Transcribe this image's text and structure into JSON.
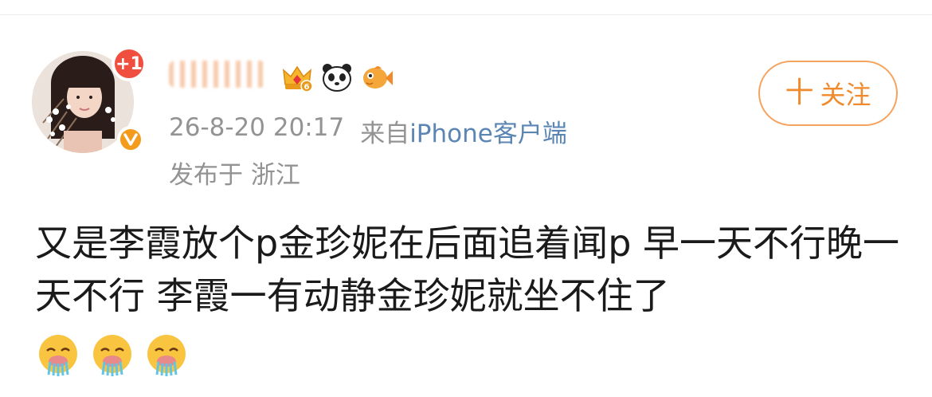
{
  "post": {
    "author": {
      "follower_badge": "+1"
    },
    "follow_button": {
      "plus": "十",
      "label": "关注"
    },
    "timestamp": "26-8-20 20:17",
    "source_prefix": "来自",
    "source": "iPhone客户端",
    "location": "发布于 浙江",
    "content": "又是李霞放个p金珍妮在后面追着闻p 早一天不行晚一天不行 李霞一有动静金珍妮就坐不住了",
    "icons": {
      "badges": [
        "crown-level-6-badge-icon",
        "panda-badge-icon",
        "fish-badge-icon"
      ],
      "emojis": [
        "vomit-emoji-icon",
        "vomit-emoji-icon",
        "vomit-emoji-icon"
      ]
    },
    "colors": {
      "follow": "#f08a2c",
      "link": "#5b86b3",
      "meta": "#939393",
      "badge_red": "#f04e3e",
      "vip_orange": "#f59b1b"
    }
  }
}
